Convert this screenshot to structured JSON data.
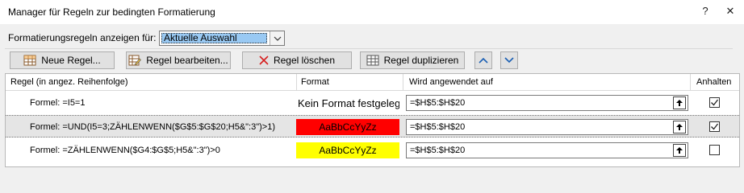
{
  "window": {
    "title": "Manager für Regeln zur bedingten Formatierung",
    "help": "?",
    "close": "✕"
  },
  "filter": {
    "label": "Formatierungsregeln anzeigen für:",
    "selected": "Aktuelle Auswahl"
  },
  "toolbar": {
    "new_rule": "Neue Regel...",
    "edit_rule": "Regel bearbeiten...",
    "delete_rule": "Regel löschen",
    "duplicate_rule": "Regel duplizieren"
  },
  "table": {
    "headers": {
      "rule": "Regel (in angez. Reihenfolge)",
      "format": "Format",
      "applies_to": "Wird angewendet auf",
      "stop": "Anhalten"
    },
    "rows": [
      {
        "formula": "Formel: =I5=1",
        "format_text": "Kein Format festgelegt",
        "format_bg": "#ffffff",
        "applies": "=$H$5:$H$20",
        "stop_if_true": true,
        "selected": false
      },
      {
        "formula": "Formel: =UND(I5=3;ZÄHLENWENN($G$5:$G$20;H5&\":3\")>1)",
        "format_text": "AaBbCcYyZz",
        "format_bg": "#ff0000",
        "applies": "=$H$5:$H$20",
        "stop_if_true": true,
        "selected": true
      },
      {
        "formula": "Formel: =ZÄHLENWENN($G4:$G$5;H5&\":3\")>0",
        "format_text": "AaBbCcYyZz",
        "format_bg": "#ffff00",
        "applies": "=$H$5:$H$20",
        "stop_if_true": false,
        "selected": false
      }
    ]
  },
  "colors": {
    "selection": "#99c9f3",
    "accent_arrow": "#1a5fb4"
  }
}
